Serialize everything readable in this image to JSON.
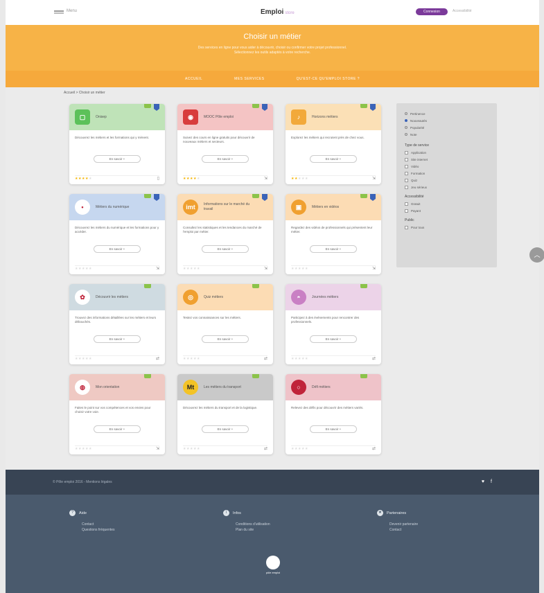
{
  "topbar": {
    "menu_label": "Menu",
    "brand": "Emploi",
    "brand_suffix": "store",
    "connect_label": "Connexion",
    "access_label": "Accessibilité"
  },
  "hero": {
    "title": "Choisir un métier",
    "subtitle_line1": "Des services en ligne pour vous aider à découvrir, choisir ou confirmer votre projet professionnel.",
    "subtitle_line2": "Sélectionnez les outils adaptés à votre recherche."
  },
  "subnav": [
    "ACCUEIL",
    "MES SERVICES",
    "QU'EST-CE QU'EMPLOI STORE ?"
  ],
  "breadcrumb": "Accueil > Choisir un métier",
  "colors": {
    "hero": "#f7b347",
    "subnav": "#f6a93c",
    "connect": "#7b3a9a",
    "footer_dark": "#384454",
    "footer": "#4a5a6d"
  },
  "cards": [
    {
      "name": "Onisep",
      "desc": "Découvrez les métiers et les formations qui y mènent.",
      "btn": "En savoir +",
      "stars": 4,
      "color": "#bfe3b8",
      "logo_bg": "#5cc15a",
      "logo": "▢",
      "icon": "bookmark-icon"
    },
    {
      "name": "MOOC Pôle emploi",
      "desc": "Suivez des cours en ligne gratuits pour découvrir de nouveaux métiers et secteurs.",
      "btn": "En savoir +",
      "stars": 4,
      "color": "#f4c4c4",
      "logo_bg": "#d83c3c",
      "logo": "◉",
      "icon": "share-icon"
    },
    {
      "name": "Horizons métiers",
      "desc": "Explorez les métiers qui recrutent près de chez vous.",
      "btn": "En savoir +",
      "stars": 2,
      "color": "#fbe0b6",
      "logo_bg": "#f2a93a",
      "logo": "♪",
      "icon": "share-icon"
    },
    {
      "name": "Métiers du numérique",
      "desc": "Découvrez les métiers du numérique et les formations pour y accéder.",
      "btn": "En savoir +",
      "stars": 0,
      "color": "#c6d7ef",
      "logo_bg": "#ffffff",
      "logo": "•",
      "icon": "share-icon"
    },
    {
      "name": "Informations sur le marché du travail",
      "desc": "Consultez les statistiques et les tendances du marché de l'emploi par métier.",
      "btn": "En savoir +",
      "stars": 0,
      "color": "#fcdcb4",
      "logo_bg": "#f0a030",
      "logo": "imt",
      "icon": "share-icon"
    },
    {
      "name": "Métiers en vidéos",
      "desc": "Regardez des vidéos de professionnels qui présentent leur métier.",
      "btn": "En savoir +",
      "stars": 0,
      "color": "#fcdcb4",
      "logo_bg": "#f0a030",
      "logo": "▣",
      "icon": "share-icon"
    },
    {
      "name": "Découvrir les métiers",
      "desc": "Trouvez des informations détaillées sur les métiers et leurs débouchés.",
      "btn": "En savoir +",
      "stars": 0,
      "color": "#cfdbe1",
      "logo_bg": "#ffffff",
      "logo": "✿",
      "icon": "chat-icon"
    },
    {
      "name": "Quiz métiers",
      "desc": "Testez vos connaissances sur les métiers.",
      "btn": "En savoir +",
      "stars": 0,
      "color": "#fcdcb4",
      "logo_bg": "#f0a030",
      "logo": "◎",
      "icon": "chat-icon"
    },
    {
      "name": "Journées métiers",
      "desc": "Participez à des événements pour rencontrer des professionnels.",
      "btn": "En savoir +",
      "stars": 0,
      "color": "#ecd3e8",
      "logo_bg": "#c980c4",
      "logo": "◓",
      "icon": "chat-icon"
    },
    {
      "name": "Mon orientation",
      "desc": "Faites le point sur vos compétences et vos envies pour choisir votre voie.",
      "btn": "En savoir +",
      "stars": 0,
      "color": "#efc9c3",
      "logo_bg": "#ffffff",
      "logo": "◍",
      "icon": "share-icon"
    },
    {
      "name": "Les métiers du transport",
      "desc": "Découvrez les métiers du transport et de la logistique.",
      "btn": "En savoir +",
      "stars": 0,
      "color": "#c9c9c9",
      "logo_bg": "#f3c326",
      "logo": "Mt",
      "icon": "chat-icon"
    },
    {
      "name": "Défi métiers",
      "desc": "Relevez des défis pour découvrir des métiers variés.",
      "btn": "En savoir +",
      "stars": 0,
      "color": "#efc3c9",
      "logo_bg": "#c0243a",
      "logo": "○",
      "icon": "chat-icon"
    }
  ],
  "sidebar": {
    "sort": [
      "Pertinence",
      "Nouveautés",
      "Popularité",
      "Note"
    ],
    "sort_selected": 1,
    "groups": [
      {
        "title": "Type de service",
        "items": [
          "Application",
          "Site internet",
          "Vidéo",
          "Formation",
          "Quiz",
          "Jeu sérieux"
        ]
      },
      {
        "title": "Accessibilité",
        "items": [
          "Gratuit",
          "Payant"
        ]
      },
      {
        "title": "Public",
        "items": [
          "Pour tous"
        ]
      }
    ]
  },
  "footbar": {
    "copy": "© Pôle emploi 2016 - Mentions légales",
    "social": [
      "♥",
      "f"
    ]
  },
  "footer": {
    "cols": [
      {
        "title": "Aide",
        "icon": "help-icon",
        "glyph": "?",
        "items": [
          "Contact",
          "Questions fréquentes"
        ]
      },
      {
        "title": "Infos",
        "icon": "info-icon",
        "glyph": "i",
        "items": [
          "Conditions d'utilisation",
          "Plan du site"
        ]
      },
      {
        "title": "Partenaires",
        "icon": "partner-icon",
        "glyph": "★",
        "items": [
          "Devenir partenaire",
          "Contact"
        ]
      }
    ],
    "logo_label": "pôle emploi"
  }
}
